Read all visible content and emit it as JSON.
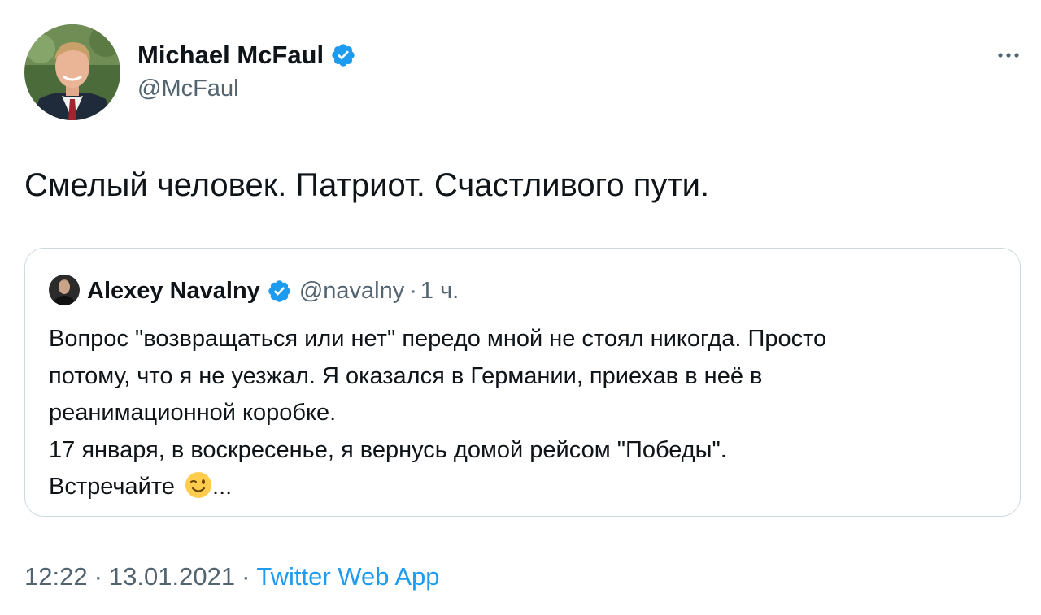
{
  "tweet": {
    "author": {
      "name": "Michael McFaul",
      "handle": "@McFaul"
    },
    "text": "Смелый человек. Патриот. Счастливого пути.",
    "quoted": {
      "author_name": "Alexey Navalny",
      "handle": "@navalny",
      "dot": "·",
      "time": "1 ч.",
      "lines": [
        "Вопрос \"возвращаться или нет\" передо мной не стоял никогда. Просто",
        "потому, что я не уезжал. Я оказался в Германии, приехав в неё в",
        "реанимационной коробке.",
        "17 января, в воскресенье, я вернусь домой рейсом \"Победы\".",
        "Встречайте"
      ],
      "ellipsis": "...",
      "emoji": "winking-face-emoji"
    },
    "meta": {
      "time": "12:22",
      "sep1": "·",
      "date": "13.01.2021",
      "sep2": "·",
      "source": "Twitter Web App"
    }
  },
  "icons": {
    "verified": "verified-badge-icon",
    "more": "more-horizontal-icon"
  },
  "colors": {
    "text_primary": "#0f1419",
    "text_secondary": "#536471",
    "accent_blue": "#1d9bf0",
    "border": "#cfd9de"
  }
}
